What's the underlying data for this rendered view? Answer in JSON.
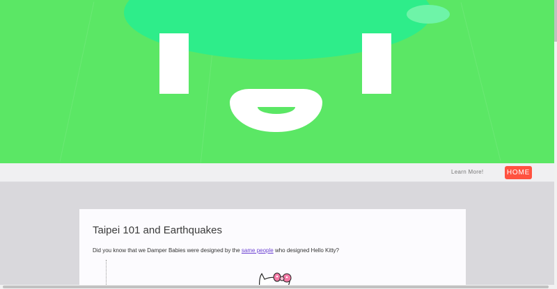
{
  "nav": {
    "learn_more_label": "Learn More!",
    "home_label": "HOME"
  },
  "article": {
    "title": "Taipei 101 and Earthquakes",
    "intro_before": "Did you know that we Damper Babies were designed by the ",
    "intro_link": "same people",
    "intro_after": " who designed Hello Kitty?"
  },
  "colors": {
    "hero_green": "#5be765",
    "hat_green": "#2eed8a",
    "home_button": "#ff5240",
    "link": "#6a3fd1",
    "page_background": "#dcdbdf"
  },
  "icons": {
    "hero_art": "damper-baby-face",
    "card_image": "hello-kitty-bow"
  }
}
